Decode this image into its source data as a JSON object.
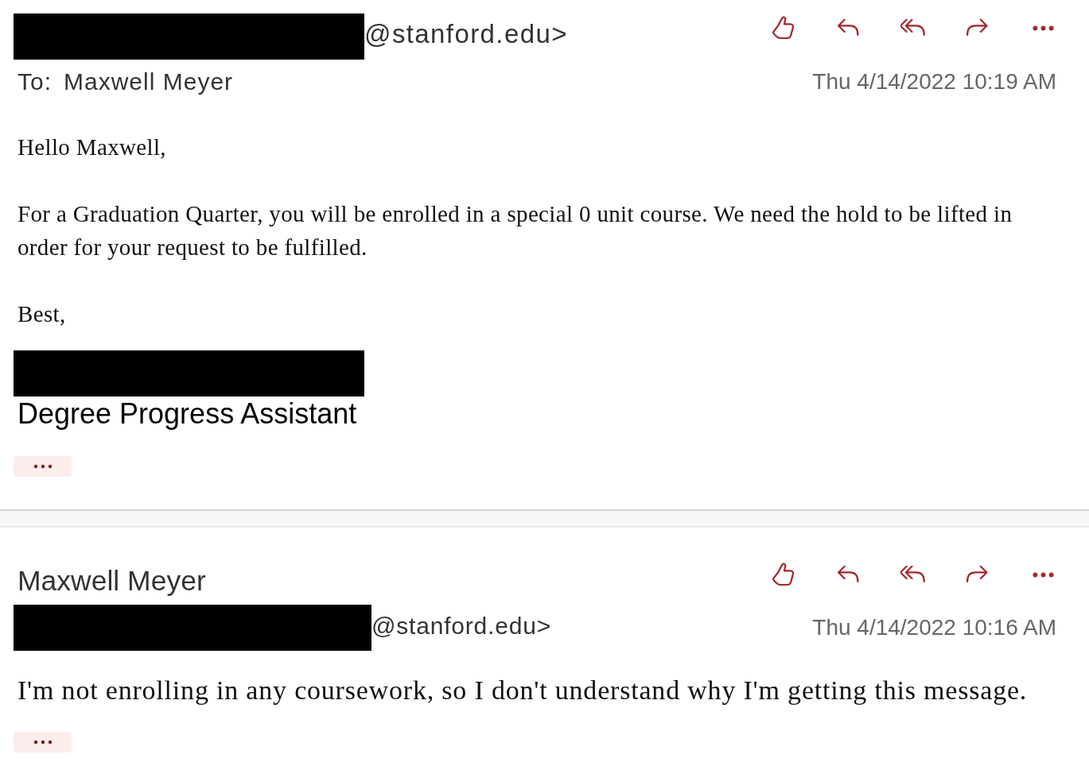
{
  "messages": [
    {
      "sender_address": {
        "redacted": true,
        "suffix": "@stanford.edu>"
      },
      "to": {
        "label": "To:",
        "name": "Maxwell Meyer"
      },
      "date": "Thu 4/14/2022 10:19 AM",
      "body": [
        "Hello Maxwell,",
        "For a Graduation Quarter, you will be enrolled in a special 0 unit course. We need the hold to be lifted in order for your request to be fulfilled.",
        "Best,"
      ],
      "signature": {
        "redacted": true,
        "title": "Degree Progress Assistant"
      }
    },
    {
      "sender_name": "Maxwell Meyer",
      "sender_address": {
        "redacted": true,
        "suffix": "@stanford.edu>"
      },
      "date": "Thu 4/14/2022 10:16 AM",
      "body": [
        "I'm not enrolling in any coursework, so I don't understand why I'm getting this message."
      ]
    }
  ]
}
